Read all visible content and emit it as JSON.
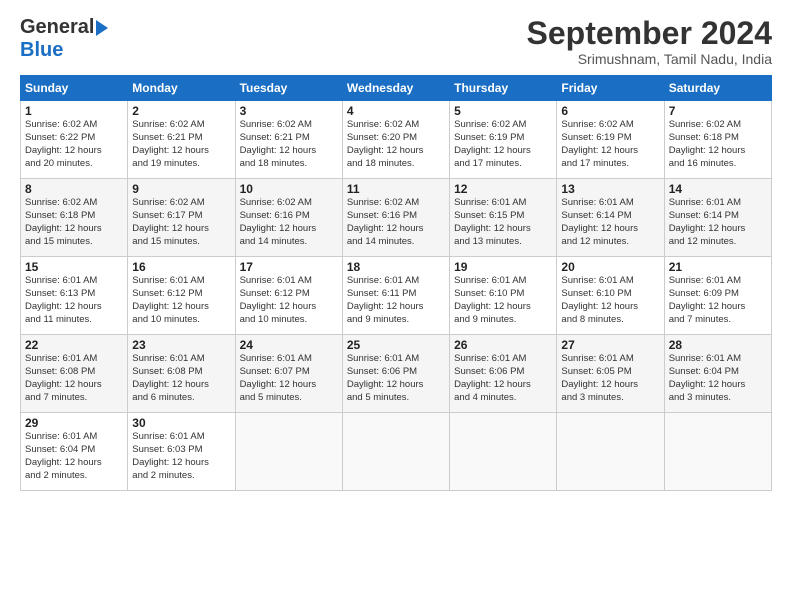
{
  "header": {
    "logo_general": "General",
    "logo_blue": "Blue",
    "month_title": "September 2024",
    "location": "Srimushnam, Tamil Nadu, India"
  },
  "calendar": {
    "headers": [
      "Sunday",
      "Monday",
      "Tuesday",
      "Wednesday",
      "Thursday",
      "Friday",
      "Saturday"
    ],
    "weeks": [
      [
        {
          "day": "1",
          "info": "Sunrise: 6:02 AM\nSunset: 6:22 PM\nDaylight: 12 hours\nand 20 minutes."
        },
        {
          "day": "2",
          "info": "Sunrise: 6:02 AM\nSunset: 6:21 PM\nDaylight: 12 hours\nand 19 minutes."
        },
        {
          "day": "3",
          "info": "Sunrise: 6:02 AM\nSunset: 6:21 PM\nDaylight: 12 hours\nand 18 minutes."
        },
        {
          "day": "4",
          "info": "Sunrise: 6:02 AM\nSunset: 6:20 PM\nDaylight: 12 hours\nand 18 minutes."
        },
        {
          "day": "5",
          "info": "Sunrise: 6:02 AM\nSunset: 6:19 PM\nDaylight: 12 hours\nand 17 minutes."
        },
        {
          "day": "6",
          "info": "Sunrise: 6:02 AM\nSunset: 6:19 PM\nDaylight: 12 hours\nand 17 minutes."
        },
        {
          "day": "7",
          "info": "Sunrise: 6:02 AM\nSunset: 6:18 PM\nDaylight: 12 hours\nand 16 minutes."
        }
      ],
      [
        {
          "day": "8",
          "info": "Sunrise: 6:02 AM\nSunset: 6:18 PM\nDaylight: 12 hours\nand 15 minutes."
        },
        {
          "day": "9",
          "info": "Sunrise: 6:02 AM\nSunset: 6:17 PM\nDaylight: 12 hours\nand 15 minutes."
        },
        {
          "day": "10",
          "info": "Sunrise: 6:02 AM\nSunset: 6:16 PM\nDaylight: 12 hours\nand 14 minutes."
        },
        {
          "day": "11",
          "info": "Sunrise: 6:02 AM\nSunset: 6:16 PM\nDaylight: 12 hours\nand 14 minutes."
        },
        {
          "day": "12",
          "info": "Sunrise: 6:01 AM\nSunset: 6:15 PM\nDaylight: 12 hours\nand 13 minutes."
        },
        {
          "day": "13",
          "info": "Sunrise: 6:01 AM\nSunset: 6:14 PM\nDaylight: 12 hours\nand 12 minutes."
        },
        {
          "day": "14",
          "info": "Sunrise: 6:01 AM\nSunset: 6:14 PM\nDaylight: 12 hours\nand 12 minutes."
        }
      ],
      [
        {
          "day": "15",
          "info": "Sunrise: 6:01 AM\nSunset: 6:13 PM\nDaylight: 12 hours\nand 11 minutes."
        },
        {
          "day": "16",
          "info": "Sunrise: 6:01 AM\nSunset: 6:12 PM\nDaylight: 12 hours\nand 10 minutes."
        },
        {
          "day": "17",
          "info": "Sunrise: 6:01 AM\nSunset: 6:12 PM\nDaylight: 12 hours\nand 10 minutes."
        },
        {
          "day": "18",
          "info": "Sunrise: 6:01 AM\nSunset: 6:11 PM\nDaylight: 12 hours\nand 9 minutes."
        },
        {
          "day": "19",
          "info": "Sunrise: 6:01 AM\nSunset: 6:10 PM\nDaylight: 12 hours\nand 9 minutes."
        },
        {
          "day": "20",
          "info": "Sunrise: 6:01 AM\nSunset: 6:10 PM\nDaylight: 12 hours\nand 8 minutes."
        },
        {
          "day": "21",
          "info": "Sunrise: 6:01 AM\nSunset: 6:09 PM\nDaylight: 12 hours\nand 7 minutes."
        }
      ],
      [
        {
          "day": "22",
          "info": "Sunrise: 6:01 AM\nSunset: 6:08 PM\nDaylight: 12 hours\nand 7 minutes."
        },
        {
          "day": "23",
          "info": "Sunrise: 6:01 AM\nSunset: 6:08 PM\nDaylight: 12 hours\nand 6 minutes."
        },
        {
          "day": "24",
          "info": "Sunrise: 6:01 AM\nSunset: 6:07 PM\nDaylight: 12 hours\nand 5 minutes."
        },
        {
          "day": "25",
          "info": "Sunrise: 6:01 AM\nSunset: 6:06 PM\nDaylight: 12 hours\nand 5 minutes."
        },
        {
          "day": "26",
          "info": "Sunrise: 6:01 AM\nSunset: 6:06 PM\nDaylight: 12 hours\nand 4 minutes."
        },
        {
          "day": "27",
          "info": "Sunrise: 6:01 AM\nSunset: 6:05 PM\nDaylight: 12 hours\nand 3 minutes."
        },
        {
          "day": "28",
          "info": "Sunrise: 6:01 AM\nSunset: 6:04 PM\nDaylight: 12 hours\nand 3 minutes."
        }
      ],
      [
        {
          "day": "29",
          "info": "Sunrise: 6:01 AM\nSunset: 6:04 PM\nDaylight: 12 hours\nand 2 minutes."
        },
        {
          "day": "30",
          "info": "Sunrise: 6:01 AM\nSunset: 6:03 PM\nDaylight: 12 hours\nand 2 minutes."
        },
        {
          "day": "",
          "info": ""
        },
        {
          "day": "",
          "info": ""
        },
        {
          "day": "",
          "info": ""
        },
        {
          "day": "",
          "info": ""
        },
        {
          "day": "",
          "info": ""
        }
      ]
    ]
  }
}
